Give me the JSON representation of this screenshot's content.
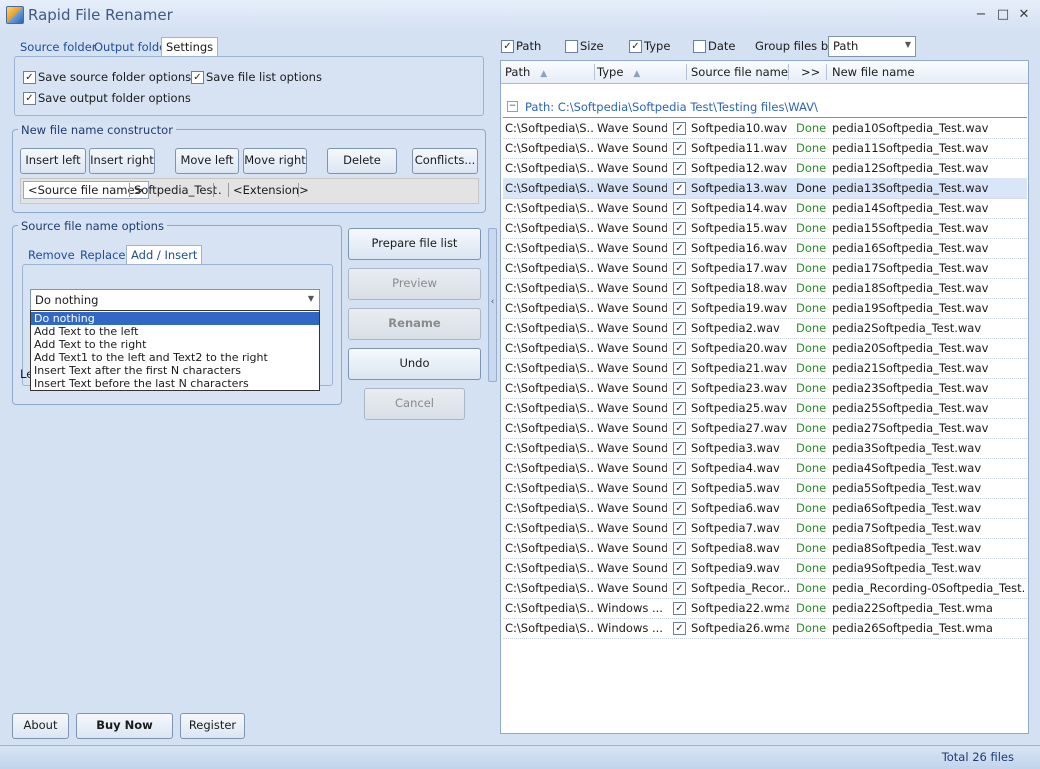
{
  "window": {
    "title": "Rapid File Renamer",
    "minimize": "−",
    "maximize": "□",
    "close": "✕"
  },
  "left_tabs": [
    "Source folder",
    "Output folder",
    "Settings"
  ],
  "settings": {
    "save_source": "Save source folder options",
    "save_filelist": "Save file list options",
    "save_output": "Save output folder options"
  },
  "constructor": {
    "legend": "New file name constructor",
    "buttons": [
      "Insert left",
      "Insert right",
      "Move left",
      "Move right",
      "Delete",
      "Conflicts..."
    ],
    "tokens": [
      "<Source file name>",
      "Softpedia_Test",
      ".",
      "<Extension>"
    ]
  },
  "source_options": {
    "legend": "Source file name options",
    "tabs": [
      "Remove",
      "Replace",
      "Add / Insert"
    ],
    "dropdown_value": "Do nothing",
    "options": [
      "Do nothing",
      "Add Text to the left",
      "Add Text to the right",
      "Add Text1 to the left and Text2 to the right",
      "Insert Text after the first N characters",
      "Insert Text before the last N characters"
    ],
    "hidden_label": "Le"
  },
  "actions": {
    "prepare": "Prepare file list",
    "preview": "Preview",
    "rename": "Rename",
    "undo": "Undo",
    "cancel": "Cancel"
  },
  "bottom_buttons": {
    "about": "About",
    "buy": "Buy Now",
    "register": "Register"
  },
  "filters": {
    "path": "Path",
    "size": "Size",
    "type": "Type",
    "date": "Date",
    "group_label": "Group files by",
    "group_value": "Path"
  },
  "grid": {
    "columns": {
      "path": "Path",
      "type": "Type",
      "source": "Source file name",
      "arrow": ">>",
      "new": "New file name"
    },
    "group": "Path: C:\\Softpedia\\Softpedia Test\\Testing files\\WAV\\",
    "rows": [
      {
        "path": "C:\\Softpedia\\S...",
        "type": "Wave Sound",
        "src": "Softpedia10.wav",
        "status": "Done",
        "new": "pedia10Softpedia_Test.wav"
      },
      {
        "path": "C:\\Softpedia\\S...",
        "type": "Wave Sound",
        "src": "Softpedia11.wav",
        "status": "Done",
        "new": "pedia11Softpedia_Test.wav"
      },
      {
        "path": "C:\\Softpedia\\S...",
        "type": "Wave Sound",
        "src": "Softpedia12.wav",
        "status": "Done",
        "new": "pedia12Softpedia_Test.wav"
      },
      {
        "path": "C:\\Softpedia\\S...",
        "type": "Wave Sound",
        "src": "Softpedia13.wav",
        "status": "Done",
        "new": "pedia13Softpedia_Test.wav"
      },
      {
        "path": "C:\\Softpedia\\S...",
        "type": "Wave Sound",
        "src": "Softpedia14.wav",
        "status": "Done",
        "new": "pedia14Softpedia_Test.wav"
      },
      {
        "path": "C:\\Softpedia\\S...",
        "type": "Wave Sound",
        "src": "Softpedia15.wav",
        "status": "Done",
        "new": "pedia15Softpedia_Test.wav"
      },
      {
        "path": "C:\\Softpedia\\S...",
        "type": "Wave Sound",
        "src": "Softpedia16.wav",
        "status": "Done",
        "new": "pedia16Softpedia_Test.wav"
      },
      {
        "path": "C:\\Softpedia\\S...",
        "type": "Wave Sound",
        "src": "Softpedia17.wav",
        "status": "Done",
        "new": "pedia17Softpedia_Test.wav"
      },
      {
        "path": "C:\\Softpedia\\S...",
        "type": "Wave Sound",
        "src": "Softpedia18.wav",
        "status": "Done",
        "new": "pedia18Softpedia_Test.wav"
      },
      {
        "path": "C:\\Softpedia\\S...",
        "type": "Wave Sound",
        "src": "Softpedia19.wav",
        "status": "Done",
        "new": "pedia19Softpedia_Test.wav"
      },
      {
        "path": "C:\\Softpedia\\S...",
        "type": "Wave Sound",
        "src": "Softpedia2.wav",
        "status": "Done",
        "new": "pedia2Softpedia_Test.wav"
      },
      {
        "path": "C:\\Softpedia\\S...",
        "type": "Wave Sound",
        "src": "Softpedia20.wav",
        "status": "Done",
        "new": "pedia20Softpedia_Test.wav"
      },
      {
        "path": "C:\\Softpedia\\S...",
        "type": "Wave Sound",
        "src": "Softpedia21.wav",
        "status": "Done",
        "new": "pedia21Softpedia_Test.wav"
      },
      {
        "path": "C:\\Softpedia\\S...",
        "type": "Wave Sound",
        "src": "Softpedia23.wav",
        "status": "Done",
        "new": "pedia23Softpedia_Test.wav"
      },
      {
        "path": "C:\\Softpedia\\S...",
        "type": "Wave Sound",
        "src": "Softpedia25.wav",
        "status": "Done",
        "new": "pedia25Softpedia_Test.wav"
      },
      {
        "path": "C:\\Softpedia\\S...",
        "type": "Wave Sound",
        "src": "Softpedia27.wav",
        "status": "Done",
        "new": "pedia27Softpedia_Test.wav"
      },
      {
        "path": "C:\\Softpedia\\S...",
        "type": "Wave Sound",
        "src": "Softpedia3.wav",
        "status": "Done",
        "new": "pedia3Softpedia_Test.wav"
      },
      {
        "path": "C:\\Softpedia\\S...",
        "type": "Wave Sound",
        "src": "Softpedia4.wav",
        "status": "Done",
        "new": "pedia4Softpedia_Test.wav"
      },
      {
        "path": "C:\\Softpedia\\S...",
        "type": "Wave Sound",
        "src": "Softpedia5.wav",
        "status": "Done",
        "new": "pedia5Softpedia_Test.wav"
      },
      {
        "path": "C:\\Softpedia\\S...",
        "type": "Wave Sound",
        "src": "Softpedia6.wav",
        "status": "Done",
        "new": "pedia6Softpedia_Test.wav"
      },
      {
        "path": "C:\\Softpedia\\S...",
        "type": "Wave Sound",
        "src": "Softpedia7.wav",
        "status": "Done",
        "new": "pedia7Softpedia_Test.wav"
      },
      {
        "path": "C:\\Softpedia\\S...",
        "type": "Wave Sound",
        "src": "Softpedia8.wav",
        "status": "Done",
        "new": "pedia8Softpedia_Test.wav"
      },
      {
        "path": "C:\\Softpedia\\S...",
        "type": "Wave Sound",
        "src": "Softpedia9.wav",
        "status": "Done",
        "new": "pedia9Softpedia_Test.wav"
      },
      {
        "path": "C:\\Softpedia\\S...",
        "type": "Wave Sound",
        "src": "Softpedia_Recor...",
        "status": "Done",
        "new": "pedia_Recording-0Softpedia_Test...."
      },
      {
        "path": "C:\\Softpedia\\S...",
        "type": "Windows ...",
        "src": "Softpedia22.wma",
        "status": "Done",
        "new": "pedia22Softpedia_Test.wma"
      },
      {
        "path": "C:\\Softpedia\\S...",
        "type": "Windows ...",
        "src": "Softpedia26.wma",
        "status": "Done",
        "new": "pedia26Softpedia_Test.wma"
      }
    ],
    "highlighted_row": 3
  },
  "status": {
    "total": "Total 26 files"
  },
  "colors": {
    "accent": "#1f4c9b",
    "done": "#2a8c2a",
    "selection": "#3168c5"
  }
}
